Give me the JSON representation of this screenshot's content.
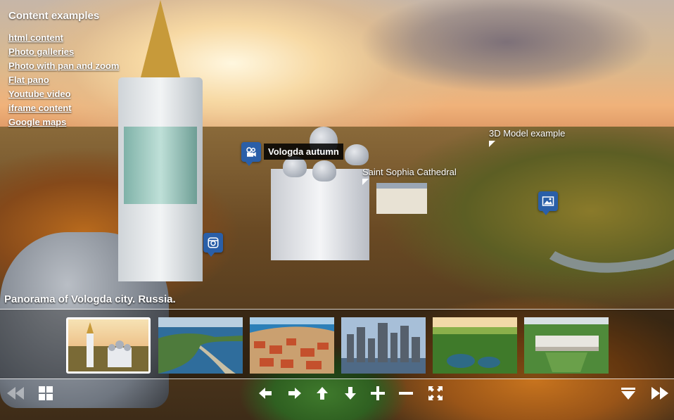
{
  "content_menu": {
    "title": "Content examples",
    "items": [
      {
        "label": "html content"
      },
      {
        "label": "Photo galleries"
      },
      {
        "label": "Photo with pan and zoom"
      },
      {
        "label": "Flat pano"
      },
      {
        "label": "Youtube video"
      },
      {
        "label": "iframe content"
      },
      {
        "label": "Google maps"
      }
    ]
  },
  "hotspots": {
    "video_tooltip": "Vologda autumn",
    "cathedral_label": "Saint Sophia Cathedral",
    "model_label": "3D Model example",
    "icons": [
      "video-camera-icon",
      "instagram-icon",
      "image-icon"
    ]
  },
  "caption": "Panorama of Vologda city. Russia.",
  "thumbnails": [
    {
      "name": "vologda-cathedral",
      "active": true
    },
    {
      "name": "coastal-spit",
      "active": false
    },
    {
      "name": "red-roof-town",
      "active": false
    },
    {
      "name": "city-skyline",
      "active": false
    },
    {
      "name": "forest-lake",
      "active": false
    },
    {
      "name": "palace-aerial",
      "active": false
    }
  ],
  "controls": [
    "previous-icon",
    "grid-icon",
    "arrow-left-icon",
    "arrow-right-icon",
    "arrow-up-icon",
    "arrow-down-icon",
    "zoom-in-icon",
    "zoom-out-icon",
    "fullscreen-icon",
    "hide-thumbnails-icon",
    "next-icon"
  ],
  "colors": {
    "hotspot": "#2a5fa8",
    "accent": "#ffffff"
  }
}
